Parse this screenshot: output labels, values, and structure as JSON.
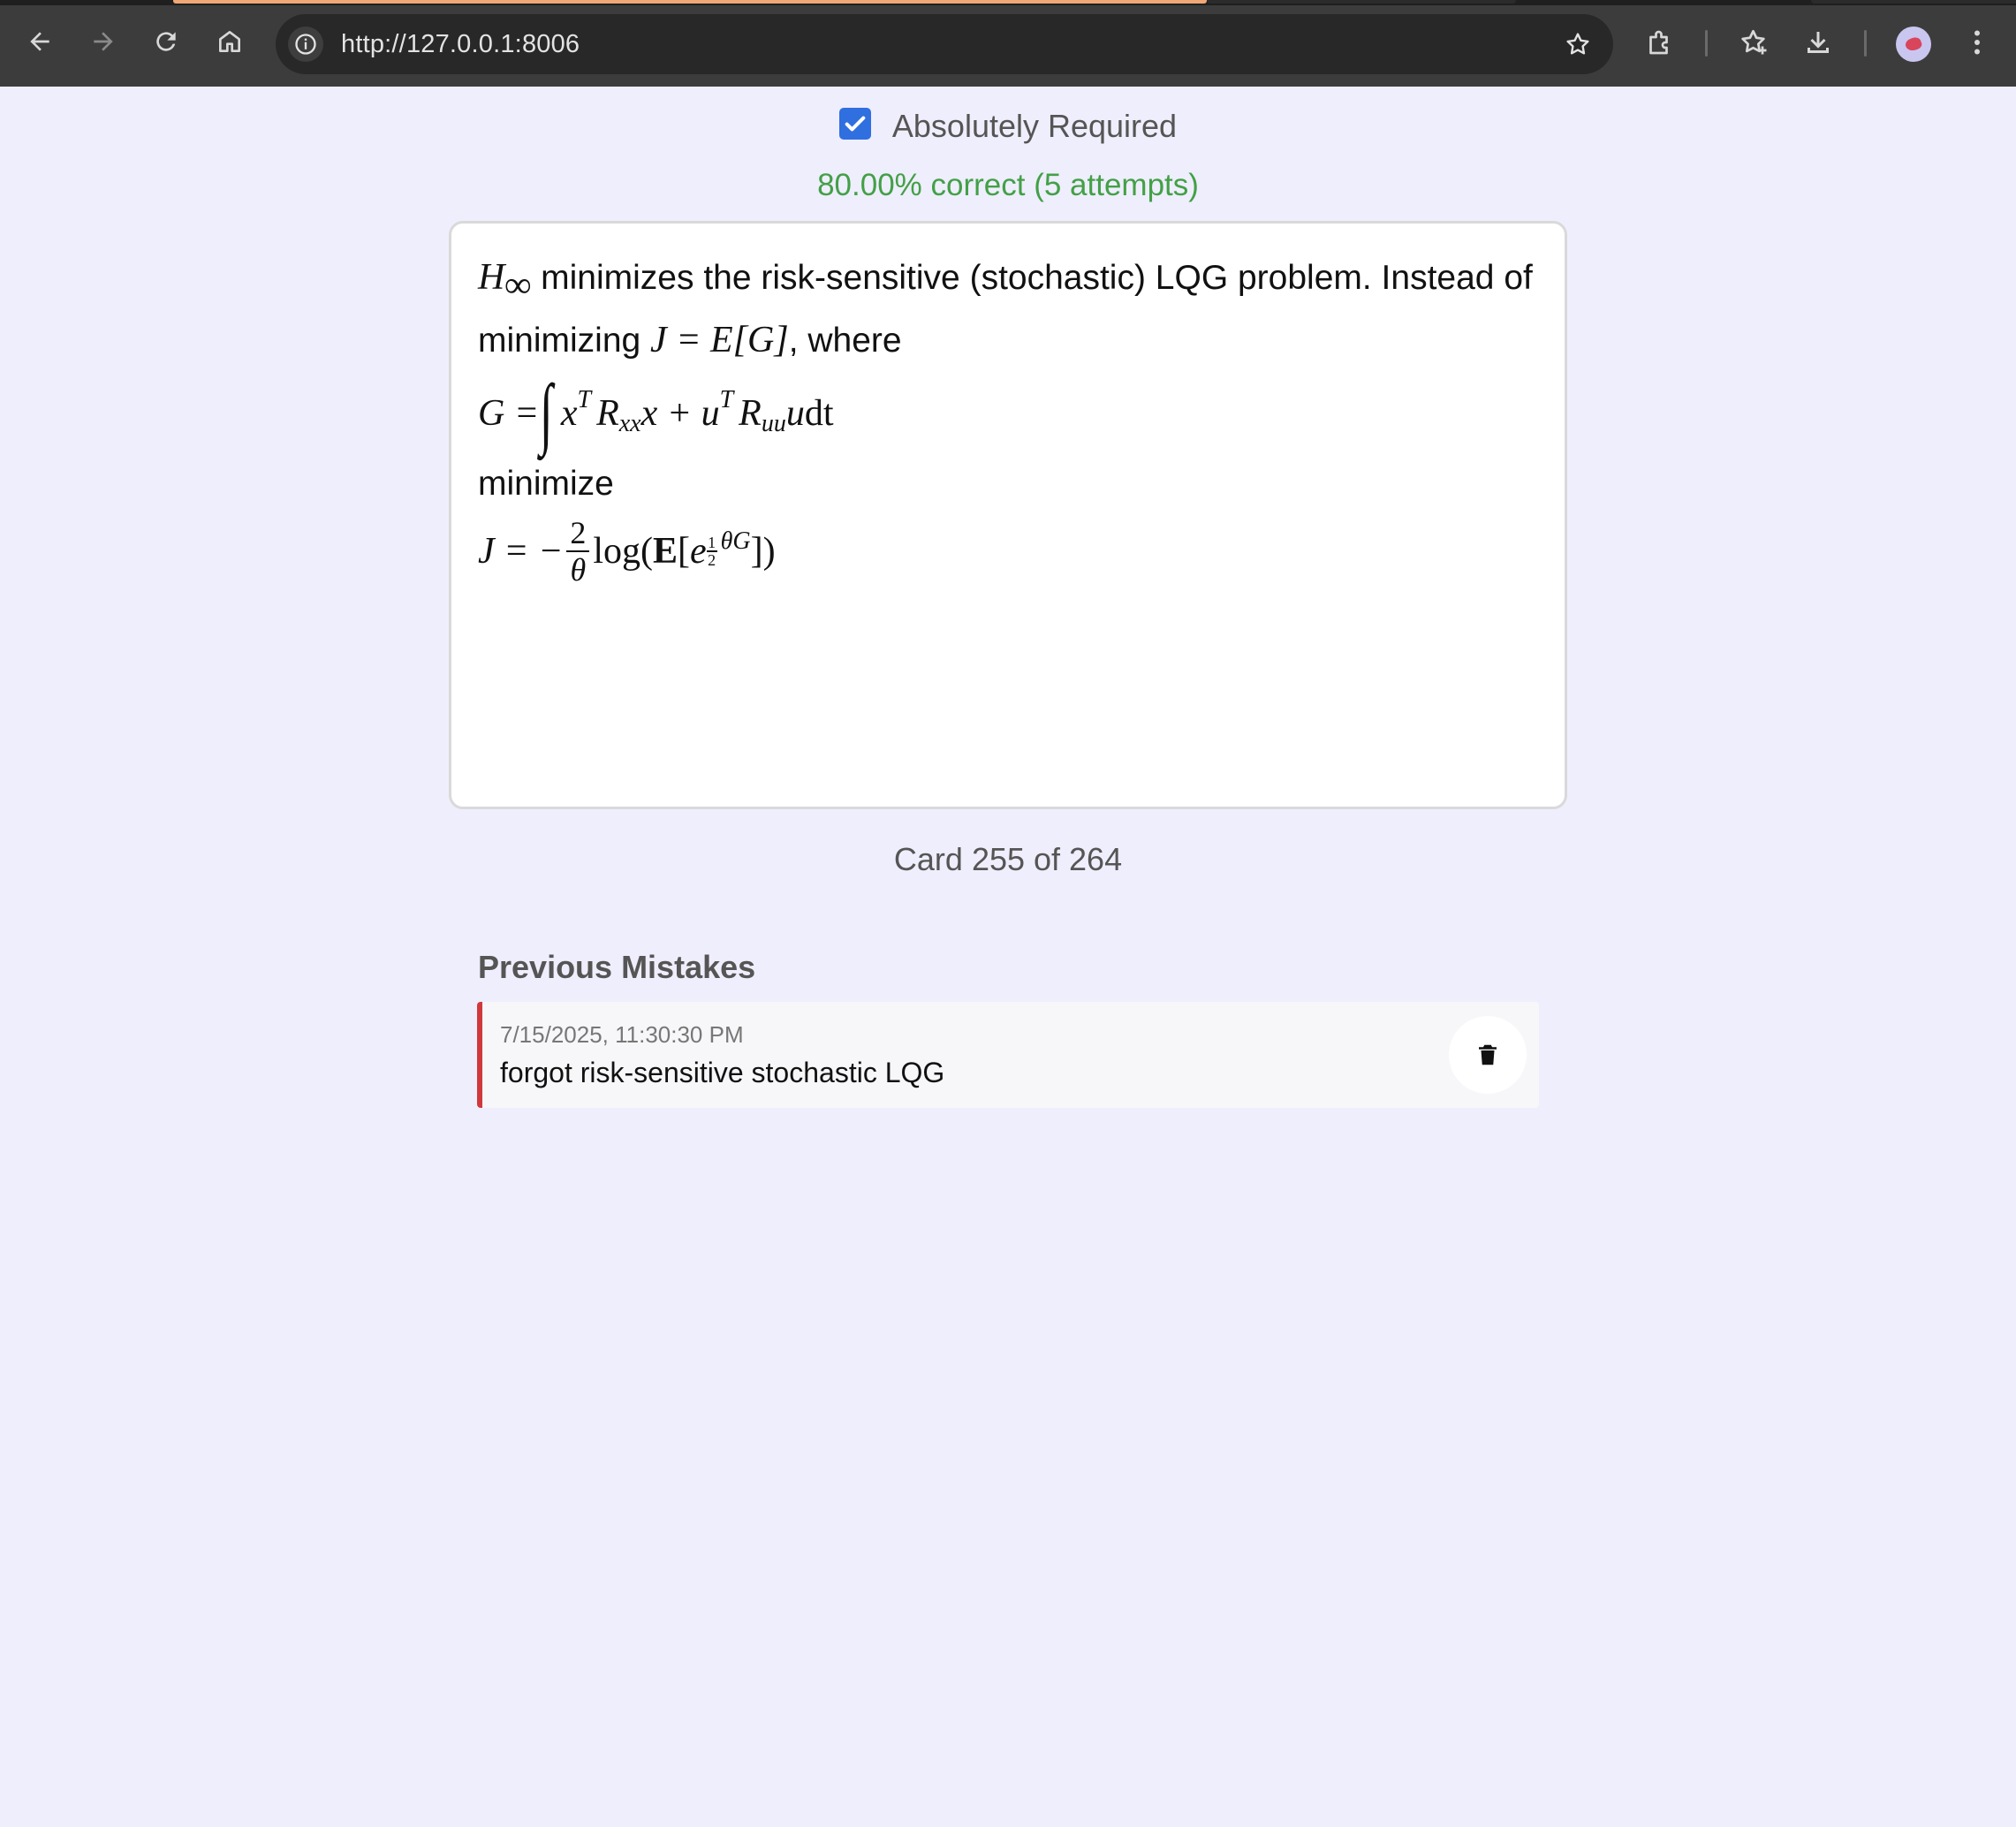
{
  "browser": {
    "url": "http://127.0.0.1:8006"
  },
  "card_header": {
    "required_label": "Absolutely Required",
    "required_checked": true,
    "stats": "80.00% correct (5 attempts)",
    "stats_color": "#43a047"
  },
  "card": {
    "line1_math": "H",
    "line1_sub": "∞",
    "line1_text": " minimizes the risk-sensitive (stochastic) LQG problem. Instead of minimizing ",
    "line1_math2": "J = E[G]",
    "line1_text2": ", where",
    "eq1": {
      "lhs": "G = ",
      "integral": "∫",
      "x": "x",
      "sup1": "T",
      "R": "R",
      "sub1": "xx",
      "x2": "x + u",
      "sup2": "T",
      "R2": "R",
      "sub2": "uu",
      "tail_var": "u",
      "tail_dt": "dt"
    },
    "mid_text": "minimize",
    "eq2": {
      "lhs": "J = −",
      "frac_num": "2",
      "frac_den": "θ",
      "log": "log(",
      "E": "E",
      "bracket_open": "[",
      "e": "e",
      "half_num": "1",
      "half_den": "2",
      "exp_rest": "θG",
      "close": "])"
    }
  },
  "counter": "Card 255 of 264",
  "mistakes": {
    "title": "Previous Mistakes",
    "accent_color": "#d0393b",
    "items": [
      {
        "date": "7/15/2025, 11:30:30 PM",
        "text": "forgot risk-sensitive stochastic LQG"
      }
    ]
  }
}
